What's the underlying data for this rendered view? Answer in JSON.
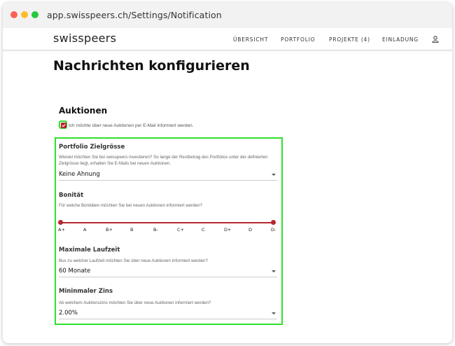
{
  "browser": {
    "url": "app.swisspeers.ch/Settings/Notification"
  },
  "navbar": {
    "logo": "swisspeers",
    "items": [
      {
        "label": "ÜBERSICHT"
      },
      {
        "label": "PORTFOLIO"
      },
      {
        "label": "PROJEKTE (4)"
      },
      {
        "label": "EINLADUNG"
      }
    ],
    "user_icon": "user-icon"
  },
  "page": {
    "title": "Nachrichten konfigurieren"
  },
  "auctions": {
    "title": "Auktionen",
    "checkbox_label": "Ich möchte über neue Auktionen per E-Mail informiert werden.",
    "checkbox_checked": true
  },
  "portfolio_size": {
    "label": "Portfolio Zielgrösse",
    "description": "Wieviel möchten Sie bei swisspeers investieren? So lange der Restbetrag des Portfolios unter der definierten Zielgrösse liegt, erhalten Sie E-Mails bei neuen Auktionen.",
    "value": "Keine Ahnung"
  },
  "rating": {
    "label": "Bonität",
    "description": "Für welche Bonitäten möchten Sie bei neuen Auktionen informiert werden?",
    "ticks": [
      "A+",
      "A",
      "B+",
      "B",
      "B-",
      "C+",
      "C",
      "D+",
      "D",
      "D-"
    ],
    "range_from": "A+",
    "range_to": "D-"
  },
  "duration": {
    "label": "Maximale Laufzeit",
    "description": "Bus zu welcher Laufzeit möchten Sie über neue Auktionen informiert werden?",
    "value": "60 Monate"
  },
  "interest": {
    "label": "Mininmaler Zins",
    "description": "Ab welchem Auktionszins möchten Sie über neue Auktionen informiert werden?",
    "value": "2.00%"
  },
  "colors": {
    "accent": "#b8272e",
    "highlight": "#2fe02f"
  }
}
